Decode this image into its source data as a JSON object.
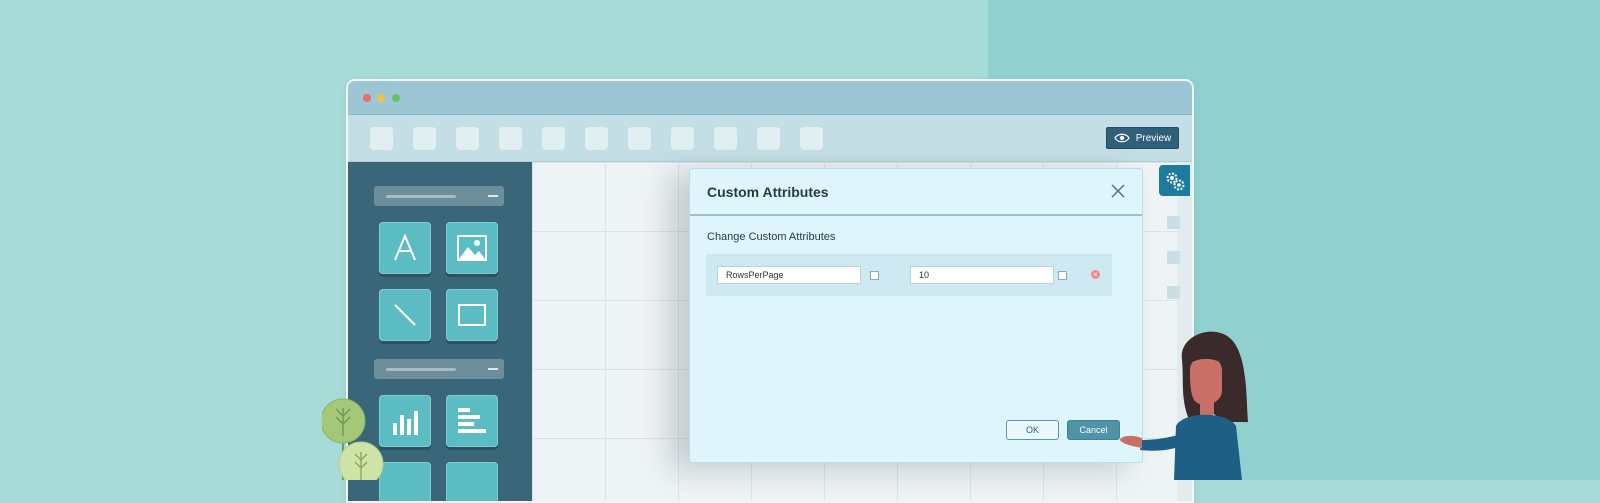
{
  "window": {
    "traffic_lights": [
      "close",
      "minimize",
      "maximize"
    ],
    "toolbar": {
      "tool_count": 11,
      "preview_label": "Preview",
      "preview_icon": "eye-icon"
    }
  },
  "left_panel": {
    "sections": [
      {
        "tiles": [
          "text-icon",
          "image-icon",
          "line-icon",
          "rectangle-icon"
        ]
      },
      {
        "tiles": [
          "bar-chart-icon",
          "horizontal-bar-icon"
        ]
      }
    ]
  },
  "dialog": {
    "title": "Custom Attributes",
    "subtitle": "Change Custom Attributes",
    "attributes": [
      {
        "name": "RowsPerPage",
        "value": "10"
      }
    ],
    "ok_label": "OK",
    "cancel_label": "Cancel"
  },
  "side_panel": {
    "icon": "gears-icon",
    "item_count": 3
  },
  "colors": {
    "background": "#a6dbd7",
    "accent": "#1d7c9c",
    "preview_button": "#2f5f7a",
    "cancel_button": "#4f93a6",
    "left_panel": "#3a6679"
  }
}
